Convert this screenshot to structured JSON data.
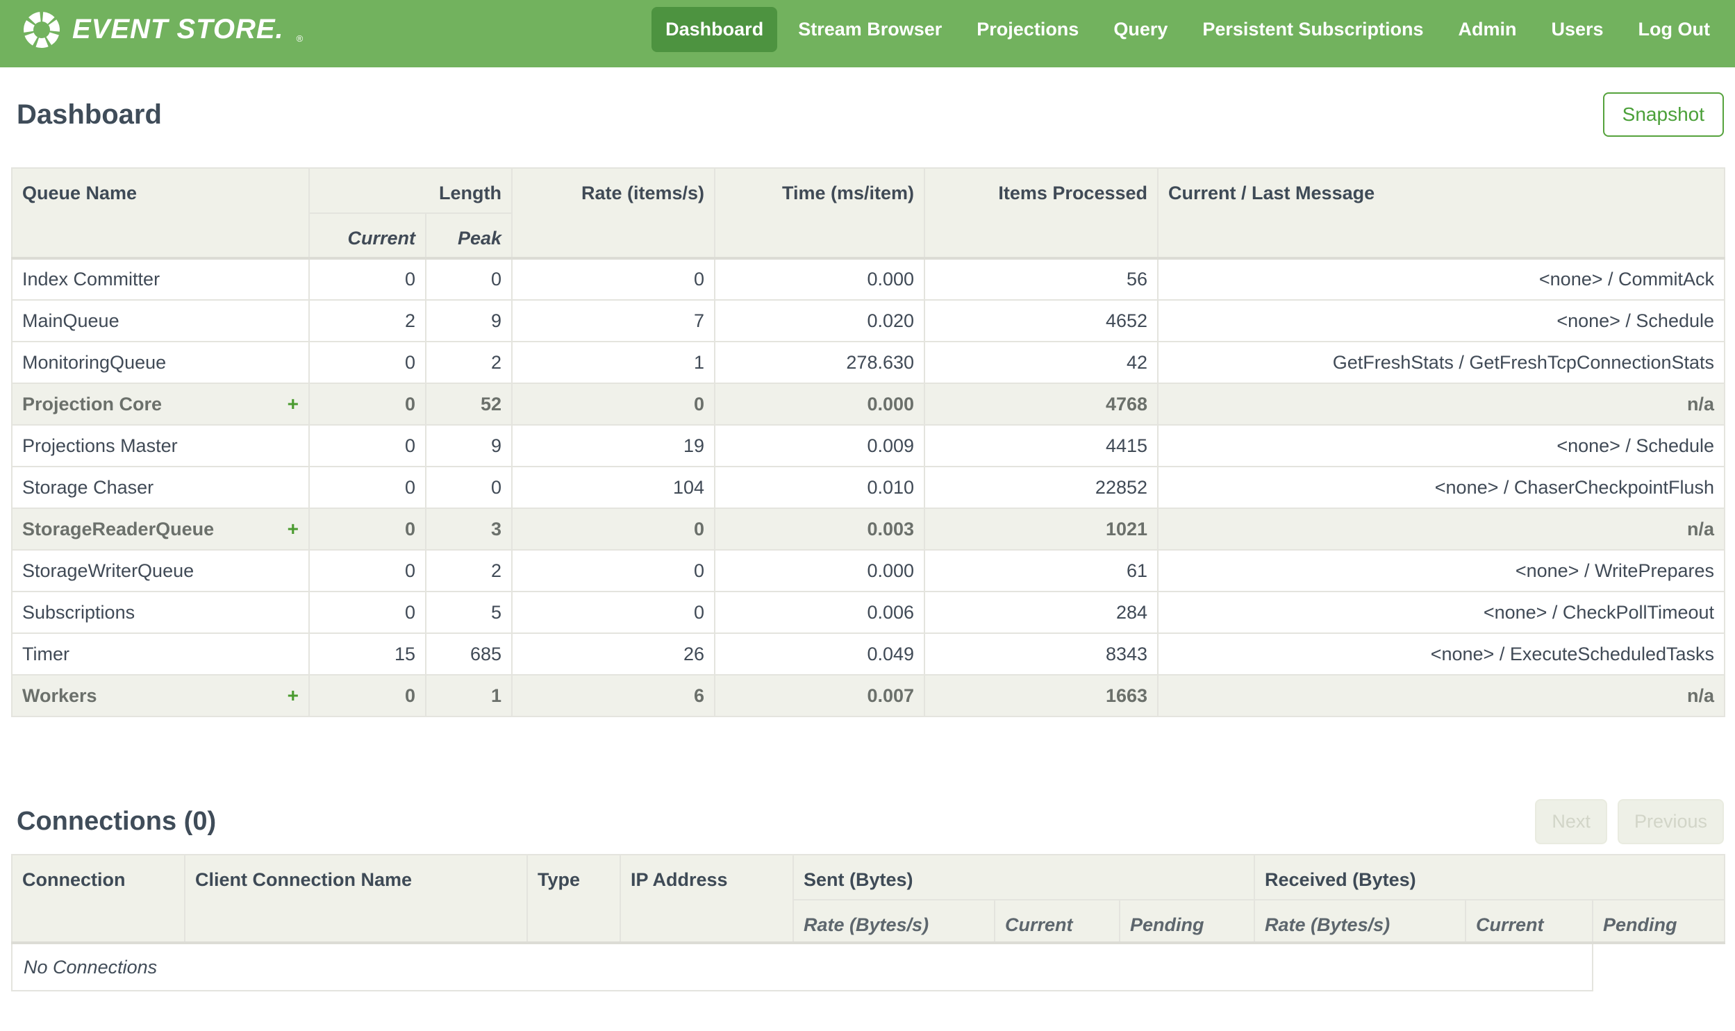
{
  "nav": {
    "brand": {
      "name": "EVENT STORE.",
      "registered_mark": "®",
      "logo_icon": "event-store-ring-logo"
    },
    "items": [
      {
        "label": "Dashboard",
        "active": true
      },
      {
        "label": "Stream Browser"
      },
      {
        "label": "Projections"
      },
      {
        "label": "Query"
      },
      {
        "label": "Persistent Subscriptions"
      },
      {
        "label": "Admin"
      },
      {
        "label": "Users"
      },
      {
        "label": "Log Out"
      }
    ]
  },
  "page": {
    "title": "Dashboard",
    "snapshot_button_label": "Snapshot"
  },
  "queues_table": {
    "headers": {
      "queue_name": "Queue Name",
      "length": "Length",
      "length_current": "Current",
      "length_peak": "Peak",
      "rate": "Rate (items/s)",
      "time": "Time (ms/item)",
      "items_processed": "Items Processed",
      "message": "Current / Last Message"
    },
    "rows": [
      {
        "name": "Index Committer",
        "group": false,
        "expander": "",
        "current": "0",
        "peak": "0",
        "rate": "0",
        "time": "0.000",
        "items": "56",
        "message": "<none> / CommitAck"
      },
      {
        "name": "MainQueue",
        "group": false,
        "expander": "",
        "current": "2",
        "peak": "9",
        "rate": "7",
        "time": "0.020",
        "items": "4652",
        "message": "<none> / Schedule"
      },
      {
        "name": "MonitoringQueue",
        "group": false,
        "expander": "",
        "current": "0",
        "peak": "2",
        "rate": "1",
        "time": "278.630",
        "items": "42",
        "message": "GetFreshStats / GetFreshTcpConnectionStats"
      },
      {
        "name": "Projection Core",
        "group": true,
        "expander": "+",
        "current": "0",
        "peak": "52",
        "rate": "0",
        "time": "0.000",
        "items": "4768",
        "message": "n/a"
      },
      {
        "name": "Projections Master",
        "group": false,
        "expander": "",
        "current": "0",
        "peak": "9",
        "rate": "19",
        "time": "0.009",
        "items": "4415",
        "message": "<none> / Schedule"
      },
      {
        "name": "Storage Chaser",
        "group": false,
        "expander": "",
        "current": "0",
        "peak": "0",
        "rate": "104",
        "time": "0.010",
        "items": "22852",
        "message": "<none> / ChaserCheckpointFlush"
      },
      {
        "name": "StorageReaderQueue",
        "group": true,
        "expander": "+",
        "current": "0",
        "peak": "3",
        "rate": "0",
        "time": "0.003",
        "items": "1021",
        "message": "n/a"
      },
      {
        "name": "StorageWriterQueue",
        "group": false,
        "expander": "",
        "current": "0",
        "peak": "2",
        "rate": "0",
        "time": "0.000",
        "items": "61",
        "message": "<none> / WritePrepares"
      },
      {
        "name": "Subscriptions",
        "group": false,
        "expander": "",
        "current": "0",
        "peak": "5",
        "rate": "0",
        "time": "0.006",
        "items": "284",
        "message": "<none> / CheckPollTimeout"
      },
      {
        "name": "Timer",
        "group": false,
        "expander": "",
        "current": "15",
        "peak": "685",
        "rate": "26",
        "time": "0.049",
        "items": "8343",
        "message": "<none> / ExecuteScheduledTasks"
      },
      {
        "name": "Workers",
        "group": true,
        "expander": "+",
        "current": "0",
        "peak": "1",
        "rate": "6",
        "time": "0.007",
        "items": "1663",
        "message": "n/a"
      }
    ]
  },
  "connections": {
    "title": "Connections (0)",
    "next_button_label": "Next",
    "previous_button_label": "Previous",
    "headers": {
      "connection": "Connection",
      "client_connection_name": "Client Connection Name",
      "type": "Type",
      "ip_address": "IP Address",
      "sent": "Sent (Bytes)",
      "received": "Received (Bytes)",
      "rate": "Rate (Bytes/s)",
      "current": "Current",
      "pending": "Pending"
    },
    "empty_message": "No Connections"
  },
  "colors": {
    "nav_background": "#72b25e",
    "nav_active_item": "#4d9340",
    "accent_green": "#55a23c",
    "expander_green": "#4a9b2f",
    "table_header_background": "#f0f1e9",
    "group_row_background": "#f0f1ea",
    "text_slate": "#404a56",
    "disabled_button_text": "#d2d5c8"
  }
}
